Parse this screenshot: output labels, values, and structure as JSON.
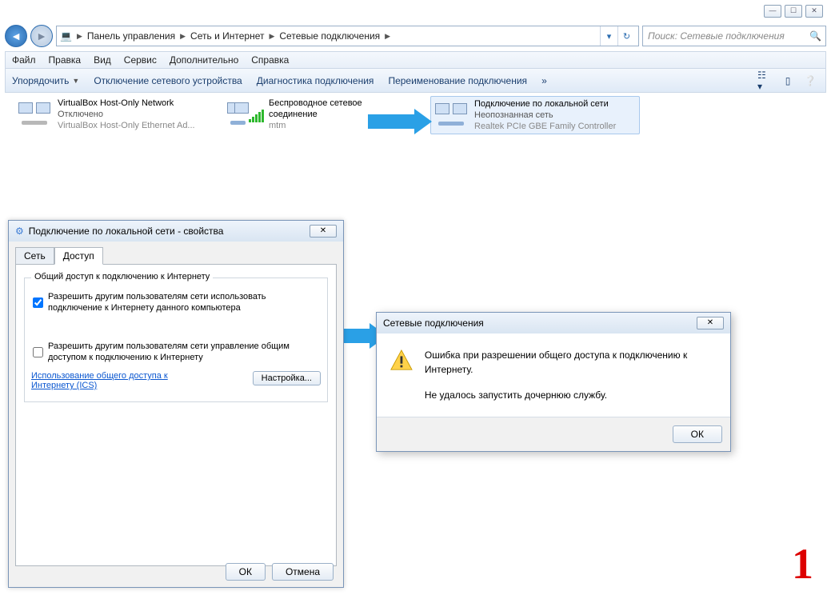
{
  "winctrl": {
    "min": "—",
    "max": "☐",
    "close": "✕"
  },
  "breadcrumbs": {
    "b1": "Панель управления",
    "b2": "Сеть и Интернет",
    "b3": "Сетевые подключения"
  },
  "search": {
    "placeholder": "Поиск: Сетевые подключения"
  },
  "menu": {
    "m1": "Файл",
    "m2": "Правка",
    "m3": "Вид",
    "m4": "Сервис",
    "m5": "Дополнительно",
    "m6": "Справка"
  },
  "toolbar": {
    "t1": "Упорядочить",
    "t2": "Отключение сетевого устройства",
    "t3": "Диагностика подключения",
    "t4": "Переименование подключения",
    "more": "»"
  },
  "connections": {
    "c1": {
      "title": "VirtualBox Host-Only Network",
      "status": "Отключено",
      "device": "VirtualBox Host-Only Ethernet Ad..."
    },
    "c2": {
      "title": "Беспроводное сетевое соединение",
      "status": "mtm",
      "device": ""
    },
    "c3": {
      "title": "Подключение по локальной сети",
      "status": "Неопознанная сеть",
      "device": "Realtek PCIe GBE Family Controller"
    }
  },
  "propdlg": {
    "title": "Подключение по локальной сети - свойства",
    "tab_net": "Сеть",
    "tab_access": "Доступ",
    "group_legend": "Общий доступ к подключению к Интернету",
    "chk1": "Разрешить другим пользователям сети использовать подключение к Интернету данного компьютера",
    "chk2": "Разрешить другим пользователям сети управление общим доступом к подключению к Интернету",
    "link": "Использование общего доступа к Интернету (ICS)",
    "settings_btn": "Настройка...",
    "ok": "ОК",
    "cancel": "Отмена"
  },
  "errdlg": {
    "title": "Сетевые подключения",
    "line1": "Ошибка при разрешении общего доступа к подключению к Интернету.",
    "line2": "Не удалось запустить дочернюю службу.",
    "ok": "ОК"
  },
  "annot": "1"
}
